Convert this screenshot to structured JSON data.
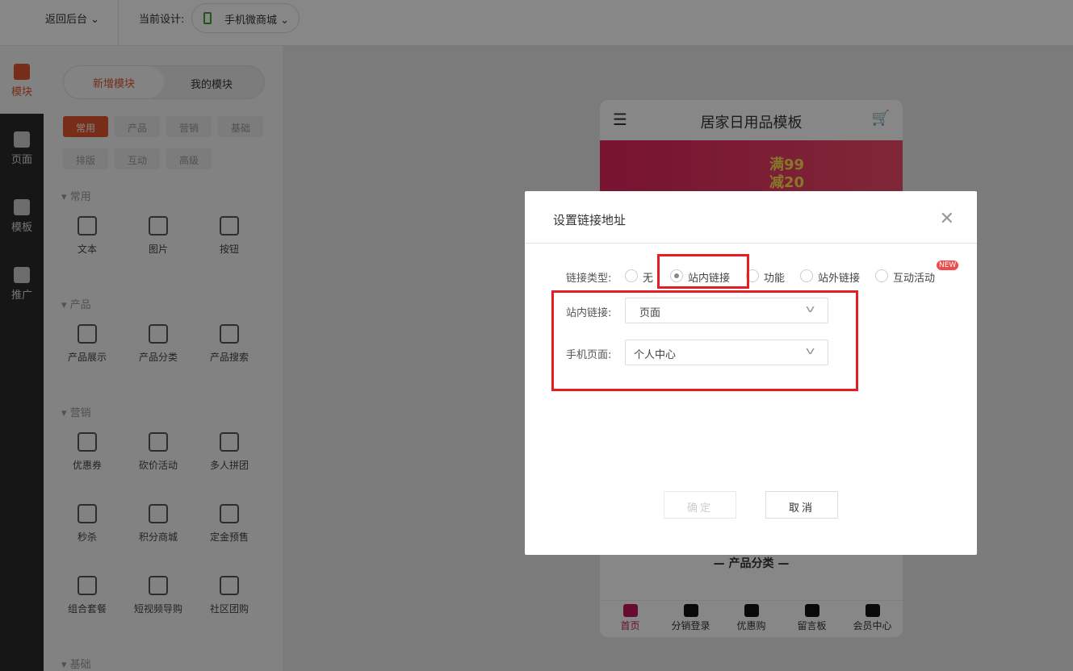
{
  "topbar": {
    "back": "返回后台",
    "current_label": "当前设计:",
    "design": "手机微商城"
  },
  "leftnav": [
    "模块",
    "页面",
    "模板",
    "推广"
  ],
  "panel": {
    "seg": [
      "新增模块",
      "我的模块"
    ],
    "chips": [
      "常用",
      "产品",
      "营销",
      "基础",
      "排版",
      "互动",
      "高级"
    ],
    "sections": [
      {
        "title": "常用",
        "items": [
          "文本",
          "图片",
          "按钮"
        ]
      },
      {
        "title": "产品",
        "items": [
          "产品展示",
          "产品分类",
          "产品搜索"
        ]
      },
      {
        "title": "营销",
        "items": [
          "优惠券",
          "砍价活动",
          "多人拼团",
          "秒杀",
          "积分商城",
          "定金预售",
          "组合套餐",
          "短视频导购",
          "社区团购"
        ]
      },
      {
        "title": "基础",
        "items": []
      }
    ]
  },
  "phone": {
    "title": "居家日用品模板",
    "banner_text": "满99减20",
    "category": "产品分类",
    "tabs": [
      "首页",
      "分销登录",
      "优惠购",
      "留言板",
      "会员中心"
    ],
    "active_color": "#c2185b"
  },
  "dialog": {
    "title": "设置链接地址",
    "link_type_label": "链接类型:",
    "types": [
      "无",
      "站内链接",
      "功能",
      "站外链接",
      "互动活动"
    ],
    "selected_type": "站内链接",
    "new_badge": "NEW",
    "inner_label": "站内链接:",
    "inner_value": "页面",
    "page_label": "手机页面:",
    "page_value": "个人中心",
    "ok": "确定",
    "cancel": "取消",
    "highlight_color": "#e81c24"
  },
  "accent": "#e0552f"
}
